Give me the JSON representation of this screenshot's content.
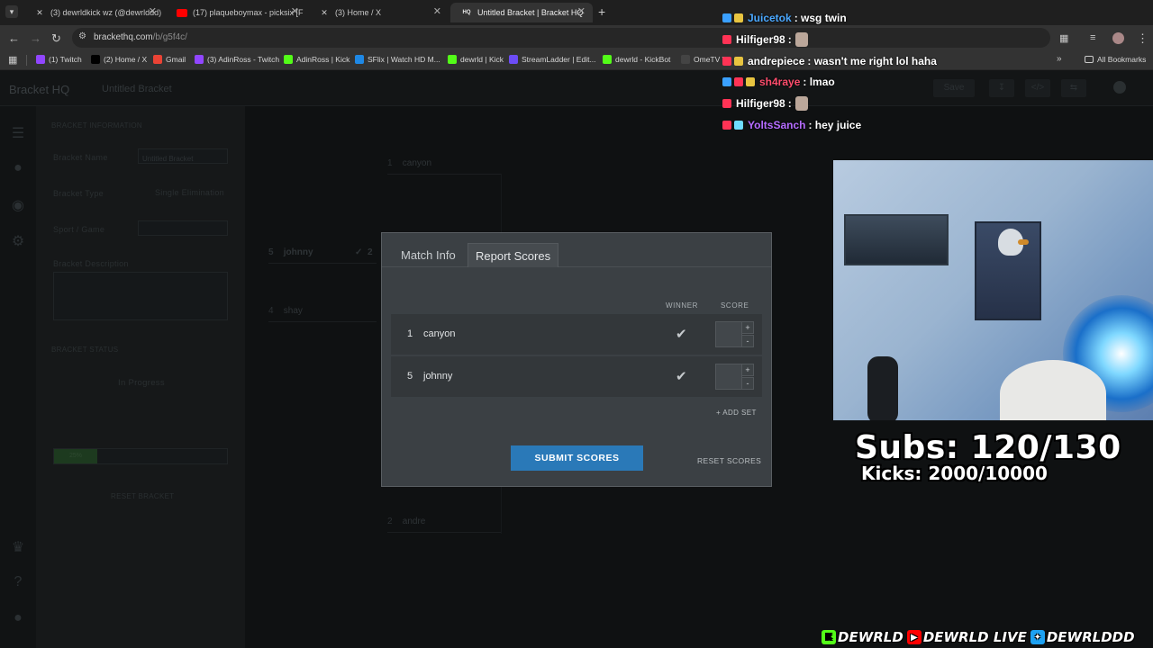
{
  "browser": {
    "tabs": [
      {
        "title": "(3) dewrldkick wz (@dewrlddd)",
        "icon": "x-icon"
      },
      {
        "title": "(17) plaqueboymax - picksix [F",
        "icon": "youtube-icon"
      },
      {
        "title": "(3) Home / X",
        "icon": "x-icon"
      },
      {
        "title": "Untitled Bracket | Bracket HQ",
        "icon": "brackethq-icon"
      }
    ],
    "new_tab": "+",
    "url_host": "brackethq.com",
    "url_path": "/b/g5f4c/",
    "bookmarks": [
      {
        "label": "(1) Twitch",
        "color": "#9146ff"
      },
      {
        "label": "(2) Home / X",
        "color": "#000000"
      },
      {
        "label": "Gmail",
        "color": "#ea4335"
      },
      {
        "label": "(3) AdinRoss - Twitch",
        "color": "#9146ff"
      },
      {
        "label": "AdinRoss | Kick",
        "color": "#53fc18"
      },
      {
        "label": "SFlix | Watch HD M...",
        "color": "#1e88e5"
      },
      {
        "label": "dewrld | Kick",
        "color": "#53fc18"
      },
      {
        "label": "StreamLadder | Edit...",
        "color": "#6c4cf5"
      },
      {
        "label": "dewrld - KickBot",
        "color": "#53fc18"
      },
      {
        "label": "OmeTV Vi",
        "color": "#444444"
      }
    ],
    "all_bookmarks": "All Bookmarks"
  },
  "app": {
    "brand": "Bracket HQ",
    "bracket_title": "Untitled Bracket",
    "save_label": "Save",
    "info": {
      "section": "BRACKET INFORMATION",
      "name_label": "Bracket Name",
      "name_value": "Untitled Bracket",
      "type_label": "Bracket Type",
      "type_value": "Single Elimination",
      "sport_label": "Sport / Game",
      "description_label": "Bracket Description",
      "status_section": "BRACKET STATUS",
      "status_value": "In Progress",
      "progress_label": "25%",
      "progress_fraction": 0.25,
      "reset_label": "RESET BRACKET"
    },
    "bracket_slots": [
      {
        "seed": "1",
        "name": "canyon"
      },
      {
        "seed": "5",
        "name": "johnny",
        "score": "2"
      },
      {
        "seed": "4",
        "name": "shay"
      },
      {
        "seed": "2",
        "name": "andre"
      }
    ]
  },
  "modal": {
    "tabs": [
      "Match Info",
      "Report Scores"
    ],
    "active_tab": 1,
    "winner_header": "WINNER",
    "score_header": "SCORE",
    "rows": [
      {
        "seed": "1",
        "name": "canyon",
        "score": ""
      },
      {
        "seed": "5",
        "name": "johnny",
        "score": ""
      }
    ],
    "add_set": "+ ADD SET",
    "submit": "SUBMIT SCORES",
    "reset": "RESET SCORES"
  },
  "chat": [
    {
      "user": "Juicetok",
      "color": "#4aa8ff",
      "message": ": wsg twin",
      "emote": false
    },
    {
      "user": "Hilfiger98",
      "color": "#ffffff",
      "message": ":",
      "emote": true
    },
    {
      "user": "andrepiece",
      "color": "#ffffff",
      "message": ": wasn't me right lol haha",
      "emote": false
    },
    {
      "user": "sh4raye",
      "color": "#ff4d6d",
      "message": ": lmao",
      "emote": false
    },
    {
      "user": "Hilfiger98",
      "color": "#ffffff",
      "message": ":",
      "emote": true
    },
    {
      "user": "YoltsSanch",
      "color": "#b56cff",
      "message": ": hey juice",
      "emote": false
    }
  ],
  "overlay": {
    "subs": "Subs: 120/130",
    "kicks": "Kicks: 2000/10000",
    "socials": [
      {
        "label": "DEWRLD",
        "icon": "kick-icon",
        "color": "#53fc18"
      },
      {
        "label": "DEWRLD LIVE",
        "icon": "youtube-icon",
        "color": "#ff0000"
      },
      {
        "label": "DEWRLDDD",
        "icon": "twitter-icon",
        "color": "#1da1f2"
      }
    ]
  }
}
